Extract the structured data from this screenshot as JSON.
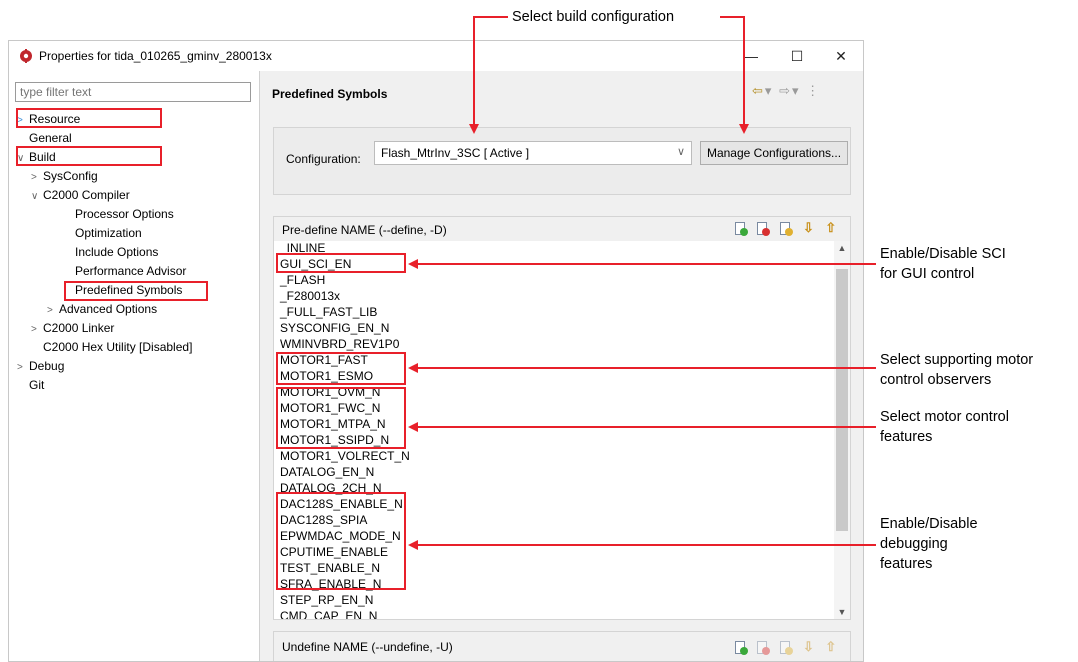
{
  "annotation": {
    "top_label": "Select build configuration",
    "callouts": [
      {
        "id": "sci",
        "lines": [
          "Enable/Disable SCI",
          "for GUI control"
        ]
      },
      {
        "id": "observers",
        "lines": [
          "Select supporting motor",
          "control observers"
        ]
      },
      {
        "id": "features",
        "lines": [
          "Select motor control",
          "features"
        ]
      },
      {
        "id": "debug",
        "lines": [
          "Enable/Disable",
          "debugging",
          "features"
        ]
      }
    ],
    "highlight_color": "#e8202a"
  },
  "window": {
    "title": "Properties for tida_010265_gminv_280013x",
    "minimize": "—",
    "maximize": "☐",
    "close": "✕"
  },
  "filter": {
    "placeholder": "type filter text"
  },
  "tree": [
    {
      "label": "Resource",
      "twisty": ">",
      "twisty_color": "blue"
    },
    {
      "label": "General",
      "twisty": ""
    },
    {
      "label": "Build",
      "twisty": "∨"
    },
    {
      "label": "SysConfig",
      "twisty": ">"
    },
    {
      "label": "C2000 Compiler",
      "twisty": "∨"
    },
    {
      "label": "Processor Options",
      "twisty": ""
    },
    {
      "label": "Optimization",
      "twisty": ""
    },
    {
      "label": "Include Options",
      "twisty": ""
    },
    {
      "label": "Performance Advisor",
      "twisty": ""
    },
    {
      "label": "Predefined Symbols",
      "twisty": "",
      "selected": true
    },
    {
      "label": "Advanced Options",
      "twisty": ">"
    },
    {
      "label": "C2000 Linker",
      "twisty": ">"
    },
    {
      "label": "C2000 Hex Utility  [Disabled]",
      "twisty": ""
    },
    {
      "label": "Debug",
      "twisty": ">"
    },
    {
      "label": "Git",
      "twisty": ""
    }
  ],
  "page": {
    "title": "Predefined Symbols"
  },
  "configuration": {
    "label": "Configuration:",
    "value": "Flash_MtrInv_3SC  [ Active ]",
    "manage_button": "Manage Configurations..."
  },
  "define_list": {
    "title": "Pre-define NAME (--define, -D)",
    "symbols": [
      "_INLINE",
      "GUI_SCI_EN",
      "_FLASH",
      "_F280013x",
      "_FULL_FAST_LIB",
      "SYSCONFIG_EN_N",
      "WMINVBRD_REV1P0",
      "MOTOR1_FAST",
      "MOTOR1_ESMO",
      "MOTOR1_OVM_N",
      "MOTOR1_FWC_N",
      "MOTOR1_MTPA_N",
      "MOTOR1_SSIPD_N",
      "MOTOR1_VOLRECT_N",
      "DATALOG_EN_N",
      "DATALOG_2CH_N",
      "DAC128S_ENABLE_N",
      "DAC128S_SPIA",
      "EPWMDAC_MODE_N",
      "CPUTIME_ENABLE",
      "TEST_ENABLE_N",
      "SFRA_ENABLE_N",
      "STEP_RP_EN_N",
      "CMD_CAP_EN_N"
    ]
  },
  "undefine_list": {
    "title": "Undefine NAME (--undefine, -U)"
  },
  "toolbar_icons": [
    "add-icon",
    "delete-icon",
    "edit-icon",
    "move-down-icon",
    "move-up-icon"
  ],
  "nav_icons": [
    "back-icon",
    "dropdown-icon",
    "forward-icon",
    "dropdown-icon",
    "menu-icon"
  ]
}
